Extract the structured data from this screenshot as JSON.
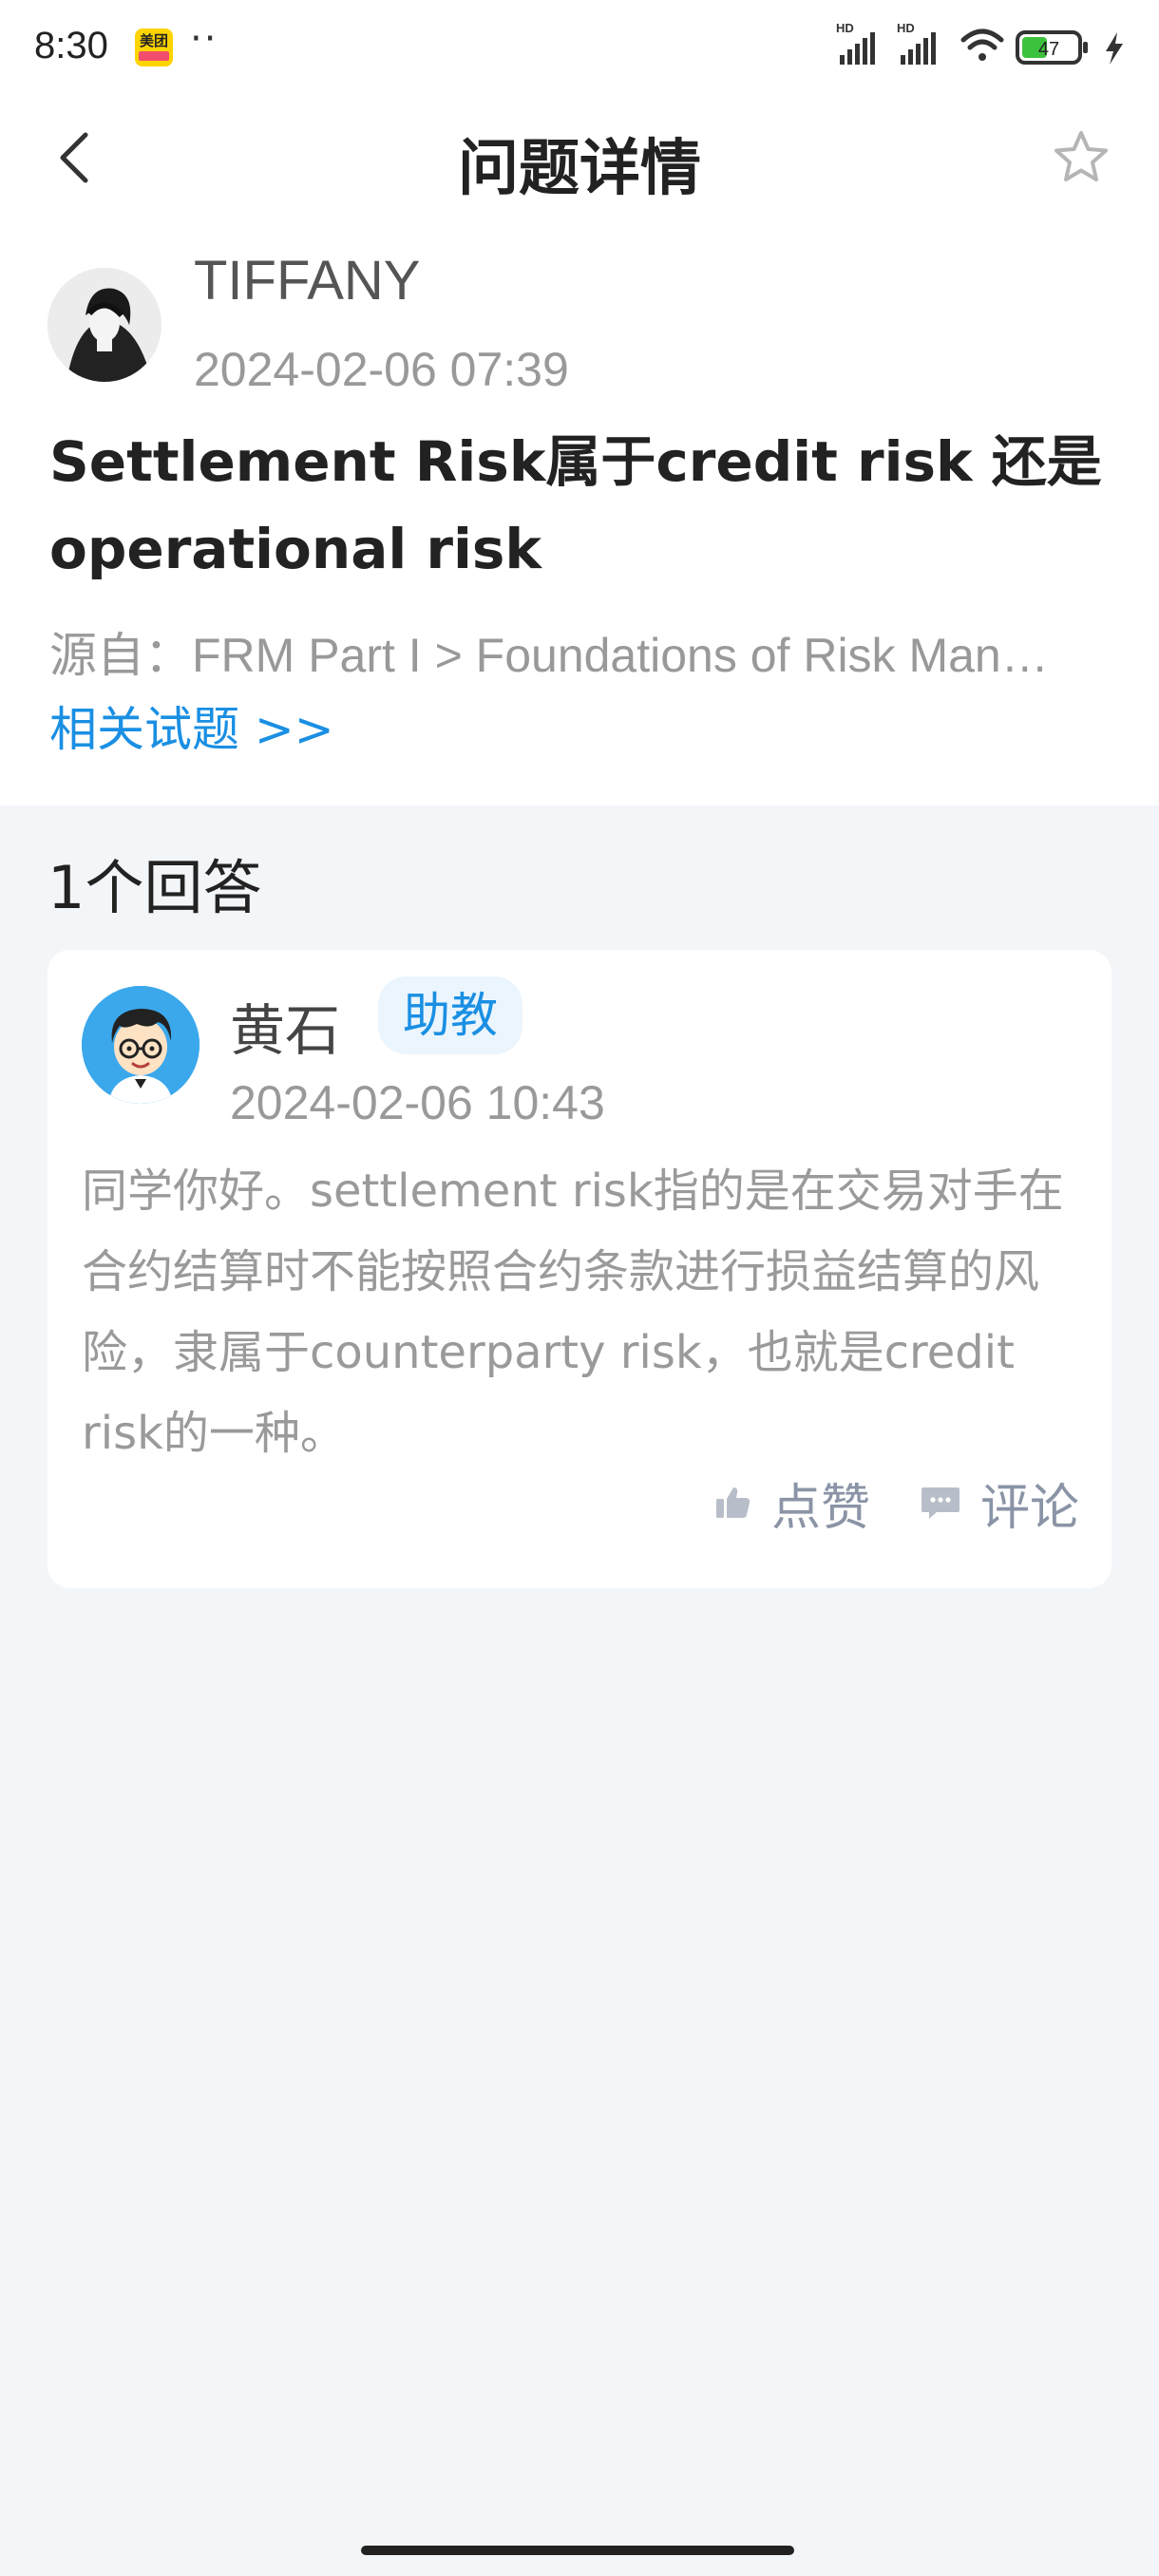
{
  "status_bar": {
    "time": "8:30",
    "app_badge": "美团",
    "dots": "··",
    "battery": "47"
  },
  "header": {
    "title": "问题详情"
  },
  "question": {
    "username": "TIFFANY",
    "time": "2024-02-06 07:39",
    "title": "Settlement Risk属于credit risk 还是operational risk",
    "source": "源自：FRM Part I > Foundations of Risk Man…",
    "related_link": "相关试题 >>"
  },
  "answers": {
    "count_label": "1个回答",
    "items": [
      {
        "name": "黄石",
        "badge": "助教",
        "time": "2024-02-06 10:43",
        "content": "同学你好。settlement risk指的是在交易对手在合约结算时不能按照合约条款进行损益结算的风险，隶属于counterparty risk，也就是credit risk的一种。",
        "like_label": "点赞",
        "comment_label": "评论"
      }
    ]
  },
  "colors": {
    "accent": "#1a8fe3",
    "page_bg": "#f3f6f9",
    "muted_text": "#999999"
  },
  "icons": {
    "back": "back-arrow-icon",
    "favorite": "star-icon",
    "like": "thumbs-up-icon",
    "comment": "comment-bubble-icon"
  }
}
